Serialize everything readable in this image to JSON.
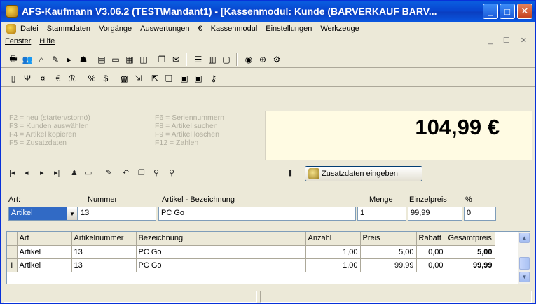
{
  "window": {
    "title": "AFS-Kaufmann V3.06.2 (TEST\\Mandant1) - [Kassenmodul: Kunde (BARVERKAUF BARV..."
  },
  "menu": {
    "row1": [
      "Datei",
      "Stammdaten",
      "Vorgänge",
      "Auswertungen",
      "Kassenmodul",
      "Einstellungen",
      "Werkzeuge"
    ],
    "row2": [
      "Fenster",
      "Hilfe"
    ],
    "mdi_controls": "_ ☐ ✕"
  },
  "shortcuts": {
    "col1": [
      "F2 = neu (starten/stornö)",
      "F3 = Kunden auswählen",
      "F4 = Artikel kopieren",
      "F5 = Zusatzdaten"
    ],
    "col2": [
      "F6 = Seriennummern",
      "F8 = Artikel suchen",
      "F9 = Artikel löschen",
      "F12 = Zahlen"
    ]
  },
  "total": "104,99 €",
  "buttons": {
    "zusatzdaten": "Zusatzdaten eingeben"
  },
  "entry": {
    "labels": {
      "art": "Art:",
      "nummer": "Nummer",
      "bezeichnung": "Artikel - Bezeichnung",
      "menge": "Menge",
      "einzelpreis": "Einzelpreis",
      "prozent": "%"
    },
    "values": {
      "art": "Artikel",
      "nummer": "13",
      "bezeichnung": "PC Go",
      "menge": "1",
      "einzelpreis": "99,99",
      "prozent": "0"
    }
  },
  "grid": {
    "columns": [
      "Art",
      "Artikelnummer",
      "Bezeichnung",
      "Anzahl",
      "Preis",
      "Rabatt",
      "Gesamtpreis"
    ],
    "rows": [
      {
        "marker": "",
        "art": "Artikel",
        "nr": "13",
        "bez": "PC Go",
        "anzahl": "1,00",
        "preis": "5,00",
        "rabatt": "0,00",
        "gesamt": "5,00"
      },
      {
        "marker": "I",
        "art": "Artikel",
        "nr": "13",
        "bez": "PC Go",
        "anzahl": "1,00",
        "preis": "99,99",
        "rabatt": "0,00",
        "gesamt": "99,99"
      }
    ]
  },
  "colors": {
    "titlebar": "#0a4fd8",
    "total_bg": "#fffbe3",
    "selection": "#316ac5"
  }
}
